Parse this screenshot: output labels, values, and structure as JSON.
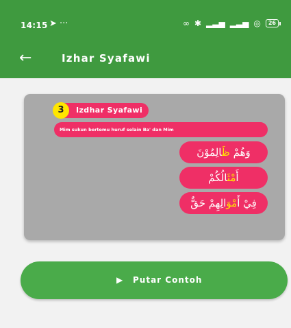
{
  "status_bar": {
    "time": "14:15",
    "left_icons": [
      "navigation-arrow-icon",
      "more-dots-icon"
    ],
    "right_icons": [
      "link-icon",
      "mute-icon",
      "signal-1-icon",
      "signal-2-icon",
      "wifi-icon"
    ],
    "battery": "26"
  },
  "app_bar": {
    "title": "Izhar Syafawi",
    "color": "#3f9a3f"
  },
  "card": {
    "number": "3",
    "heading": "Izdhar Syafawi",
    "description": "Mim sukun bertemu huruf selain Ba' dan Mim",
    "examples": [
      {
        "pre": "وَهُمْ ",
        "hl": "ظَ",
        "post": "الِمُوْنَ"
      },
      {
        "pre": "أَ",
        "hl": "مْثَ",
        "post": "الُكُمْ"
      },
      {
        "pre": "فِيْ أَ",
        "hl": "مْوَ",
        "post": "الِهِمْ حَقٌّ"
      }
    ]
  },
  "play_button": {
    "label": "Putar Contoh"
  },
  "colors": {
    "accent": "#ef2f66",
    "highlight": "#ffe600",
    "button": "#4aab4a"
  }
}
